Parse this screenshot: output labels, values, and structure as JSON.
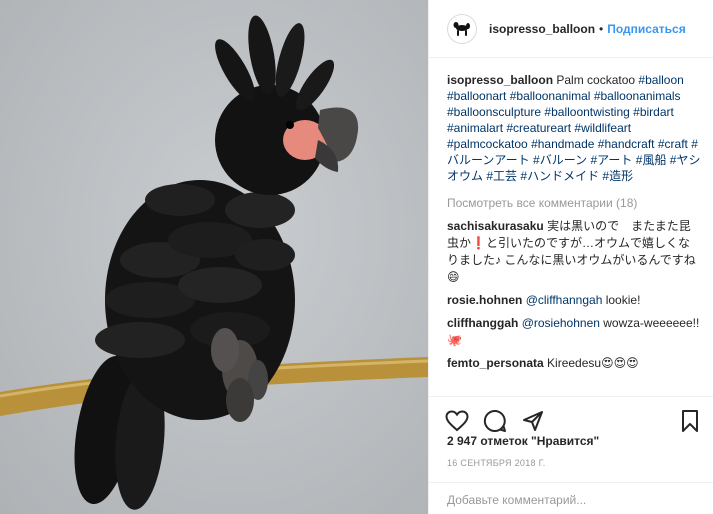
{
  "post": {
    "username": "isopresso_balloon",
    "separator": "•",
    "follow_label": "Подписаться",
    "caption_user": "isopresso_balloon",
    "caption_text": "Palm cockatoo",
    "hashtags": [
      "#balloon",
      "#balloonart",
      "#balloonanimal",
      "#balloonanimals",
      "#balloonsculpture",
      "#balloontwisting",
      "#birdart",
      "#animalart",
      "#creatureart",
      "#wildlifeart",
      "#palmcockatoo",
      "#handmade",
      "#handcraft",
      "#craft",
      "#バルーンアート",
      "#バルーン",
      "#アート",
      "#風船",
      "#ヤシオウム",
      "#工芸",
      "#ハンドメイド",
      "#造形"
    ],
    "view_all_comments": "Посмотреть все комментарии (18)",
    "comments": [
      {
        "user": "sachisakurasaku",
        "text": "実は黒いので　またまた昆虫か❗と引いたのですが…オウムで嬉しくなりました♪ こんなに黒いオウムがいるんですね😄",
        "mention": ""
      },
      {
        "user": "rosie.hohnen",
        "mention": "@cliffhanngah",
        "text": " lookie!"
      },
      {
        "user": "cliffhanggah",
        "mention": "@rosiehohnen",
        "text": " wowza-weeeeee!!🐙"
      },
      {
        "user": "femto_personata",
        "mention": "",
        "text": "Kireedesu😍😍😍"
      }
    ],
    "likes_text": "2 947 отметок \"Нравится\"",
    "date": "16 СЕНТЯБРЯ 2018 Г.",
    "add_comment_placeholder": "Добавьте комментарий..."
  },
  "icons": {
    "avatar": "balloon-dog-avatar-icon",
    "like": "heart-icon",
    "comment": "comment-bubble-icon",
    "share": "share-icon",
    "save": "bookmark-icon"
  },
  "colors": {
    "link_blue": "#3897f0",
    "hashtag": "#003569",
    "muted": "#999999",
    "text": "#262626",
    "border": "#efefef"
  }
}
